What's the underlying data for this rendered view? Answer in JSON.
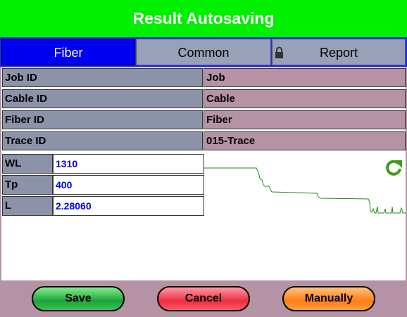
{
  "header": {
    "title": "Result Autosaving"
  },
  "tabs": [
    {
      "label": "Fiber"
    },
    {
      "label": "Common"
    },
    {
      "label": "Report"
    }
  ],
  "fields": [
    {
      "label": "Job ID",
      "value": "Job"
    },
    {
      "label": "Cable ID",
      "value": "Cable"
    },
    {
      "label": "Fiber ID",
      "value": "Fiber"
    },
    {
      "label": "Trace ID",
      "value": "015-Trace"
    }
  ],
  "params": [
    {
      "label": "WL",
      "value": "1310"
    },
    {
      "label": "Tp",
      "value": "400"
    },
    {
      "label": "L",
      "value": "2.28060"
    }
  ],
  "icons": {
    "tab_lock": "lock-icon",
    "trace_refresh": "refresh-icon"
  },
  "colors": {
    "header": "#00f000",
    "active_tab": "#0000f0",
    "trace_line": "#1a8c1a",
    "value_text": "#0000e0"
  },
  "buttons": {
    "save": "Save",
    "cancel": "Cancel",
    "manually": "Manually"
  }
}
